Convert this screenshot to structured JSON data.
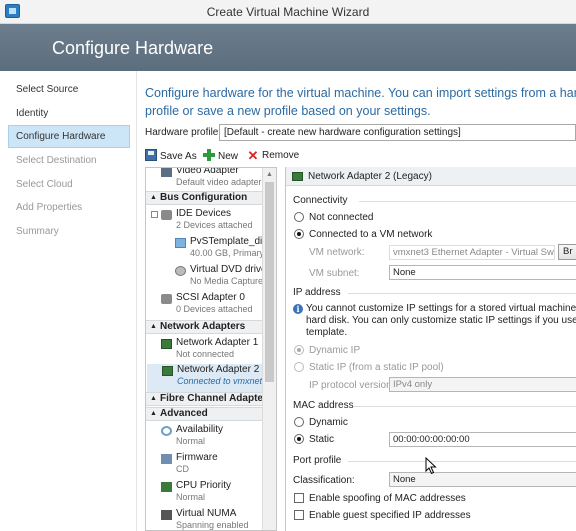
{
  "window": {
    "title": "Create Virtual Machine Wizard"
  },
  "banner": {
    "title": "Configure Hardware"
  },
  "nav": {
    "items": [
      {
        "label": "Select Source"
      },
      {
        "label": "Identity"
      },
      {
        "label": "Configure Hardware"
      },
      {
        "label": "Select Destination"
      },
      {
        "label": "Select Cloud"
      },
      {
        "label": "Add Properties"
      },
      {
        "label": "Summary"
      }
    ]
  },
  "intro": {
    "line1": "Configure hardware for the virtual machine. You can import settings from a hard",
    "line2": "profile or save a new profile based on your settings."
  },
  "hardware_profile": {
    "label": "Hardware profile:",
    "value": "[Default - create new hardware configuration settings]"
  },
  "toolbar": {
    "save_as": "Save As",
    "new": "New",
    "remove": "Remove"
  },
  "hw_list": {
    "video": {
      "name": "Video Adapter",
      "sub": "Default video adapter"
    },
    "cat_bus": "Bus Configuration",
    "ide": {
      "name": "IDE Devices",
      "sub": "2 Devices attached"
    },
    "vhd": {
      "name": "PvSTemplate_di...",
      "sub": "40.00 GB, Primary"
    },
    "dvd": {
      "name": "Virtual DVD drive",
      "sub": "No Media Captured"
    },
    "scsi": {
      "name": "SCSI Adapter 0",
      "sub": "0 Devices attached"
    },
    "cat_net": "Network Adapters",
    "nic1": {
      "name": "Network Adapter 1",
      "sub": "Not connected"
    },
    "nic2": {
      "name": "Network Adapter 2 ...",
      "sub": "Connected to vmxnet..."
    },
    "cat_fc": "Fibre Channel Adapters",
    "cat_adv": "Advanced",
    "avail": {
      "name": "Availability",
      "sub": "Normal"
    },
    "firm": {
      "name": "Firmware",
      "sub": "CD"
    },
    "cpu": {
      "name": "CPU Priority",
      "sub": "Normal"
    },
    "numa": {
      "name": "Virtual NUMA",
      "sub": "Spanning enabled"
    }
  },
  "detail": {
    "header": "Network Adapter 2 (Legacy)",
    "connectivity": {
      "heading": "Connectivity",
      "not_connected": "Not connected",
      "connected_vm": "Connected to a VM network",
      "vm_network_label": "VM network:",
      "vm_network_value": "vmxnet3 Ethernet Adapter - Virtual Swit",
      "browse_label": "Br",
      "vm_subnet_label": "VM subnet:",
      "vm_subnet_value": "None"
    },
    "ip": {
      "heading": "IP address",
      "info_line1": "You cannot customize IP settings for a stored virtual machine or a",
      "info_line2": "hard disk. You can only customize static IP settings if you use a VM",
      "info_line3": "template.",
      "dynamic_ip": "Dynamic IP",
      "static_ip": "Static IP (from a static IP pool)",
      "protocol_label": "IP protocol version:",
      "protocol_value": "IPv4 only"
    },
    "mac": {
      "heading": "MAC address",
      "dynamic": "Dynamic",
      "static": "Static",
      "static_value": "00:00:00:00:00:00"
    },
    "port": {
      "heading": "Port profile",
      "classification_label": "Classification:",
      "classification_value": "None",
      "spoofing": "Enable spoofing of MAC addresses",
      "guest_ip": "Enable guest specified IP addresses"
    }
  }
}
